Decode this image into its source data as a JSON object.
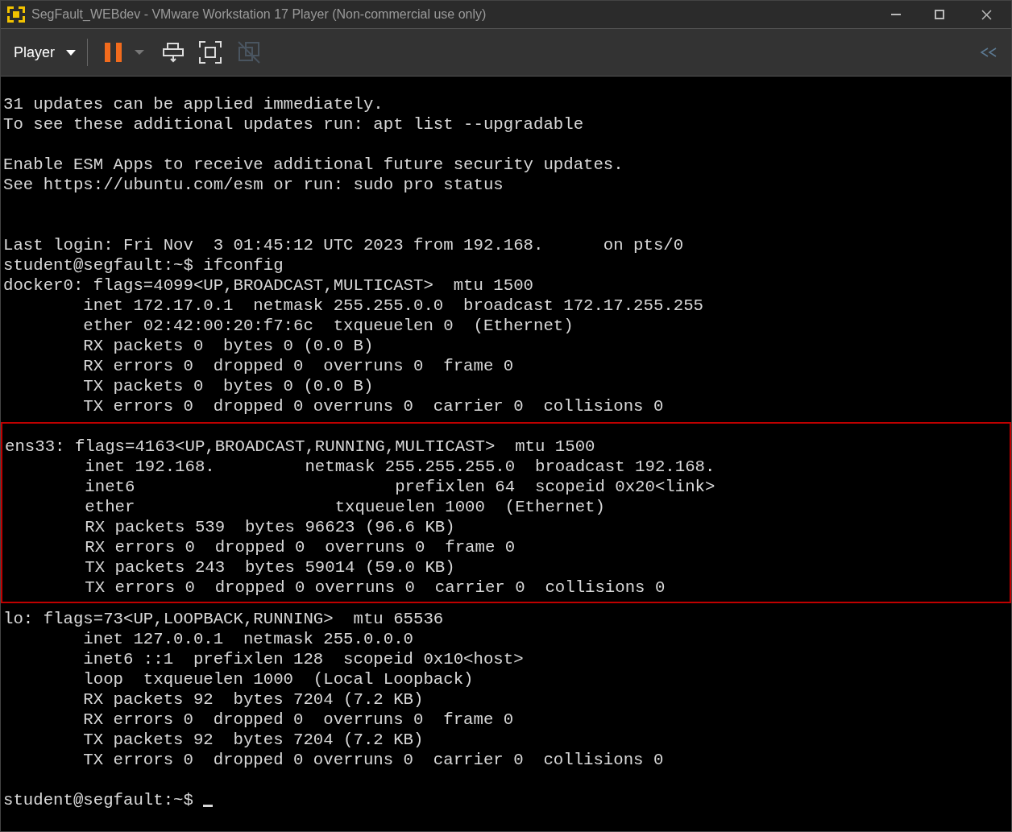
{
  "window": {
    "title": "SegFault_WEBdev - VMware Workstation 17 Player (Non-commercial use only)"
  },
  "toolbar": {
    "menu_label": "Player",
    "paused": true,
    "unity_disabled": true
  },
  "terminal": {
    "blocks": [
      {
        "highlighted": false,
        "lines": [
          "31 updates can be applied immediately.",
          "To see these additional updates run: apt list --upgradable"
        ]
      },
      {
        "highlighted": false,
        "lines": [
          "Enable ESM Apps to receive additional future security updates.",
          "See https://ubuntu.com/esm or run: sudo pro status"
        ]
      },
      {
        "highlighted": false,
        "lines": [
          "Last login: Fri Nov  3 01:45:12 UTC 2023 from 192.168.      on pts/0",
          "student@segfault:~$ ifconfig",
          "docker0: flags=4099<UP,BROADCAST,MULTICAST>  mtu 1500",
          "        inet 172.17.0.1  netmask 255.255.0.0  broadcast 172.17.255.255",
          "        ether 02:42:00:20:f7:6c  txqueuelen 0  (Ethernet)",
          "        RX packets 0  bytes 0 (0.0 B)",
          "        RX errors 0  dropped 0  overruns 0  frame 0",
          "        TX packets 0  bytes 0 (0.0 B)",
          "        TX errors 0  dropped 0 overruns 0  carrier 0  collisions 0"
        ]
      },
      {
        "highlighted": true,
        "lines": [
          "ens33: flags=4163<UP,BROADCAST,RUNNING,MULTICAST>  mtu 1500",
          "        inet 192.168.         netmask 255.255.255.0  broadcast 192.168.",
          "        inet6                          prefixlen 64  scopeid 0x20<link>",
          "        ether                    txqueuelen 1000  (Ethernet)",
          "        RX packets 539  bytes 96623 (96.6 KB)",
          "        RX errors 0  dropped 0  overruns 0  frame 0",
          "        TX packets 243  bytes 59014 (59.0 KB)",
          "        TX errors 0  dropped 0 overruns 0  carrier 0  collisions 0"
        ]
      },
      {
        "highlighted": false,
        "lines": [
          "lo: flags=73<UP,LOOPBACK,RUNNING>  mtu 65536",
          "        inet 127.0.0.1  netmask 255.0.0.0",
          "        inet6 ::1  prefixlen 128  scopeid 0x10<host>",
          "        loop  txqueuelen 1000  (Local Loopback)",
          "        RX packets 92  bytes 7204 (7.2 KB)",
          "        RX errors 0  dropped 0  overruns 0  frame 0",
          "        TX packets 92  bytes 7204 (7.2 KB)",
          "        TX errors 0  dropped 0 overruns 0  carrier 0  collisions 0"
        ]
      },
      {
        "highlighted": false,
        "lines": [
          "student@segfault:~$ "
        ],
        "cursor": true
      }
    ]
  }
}
